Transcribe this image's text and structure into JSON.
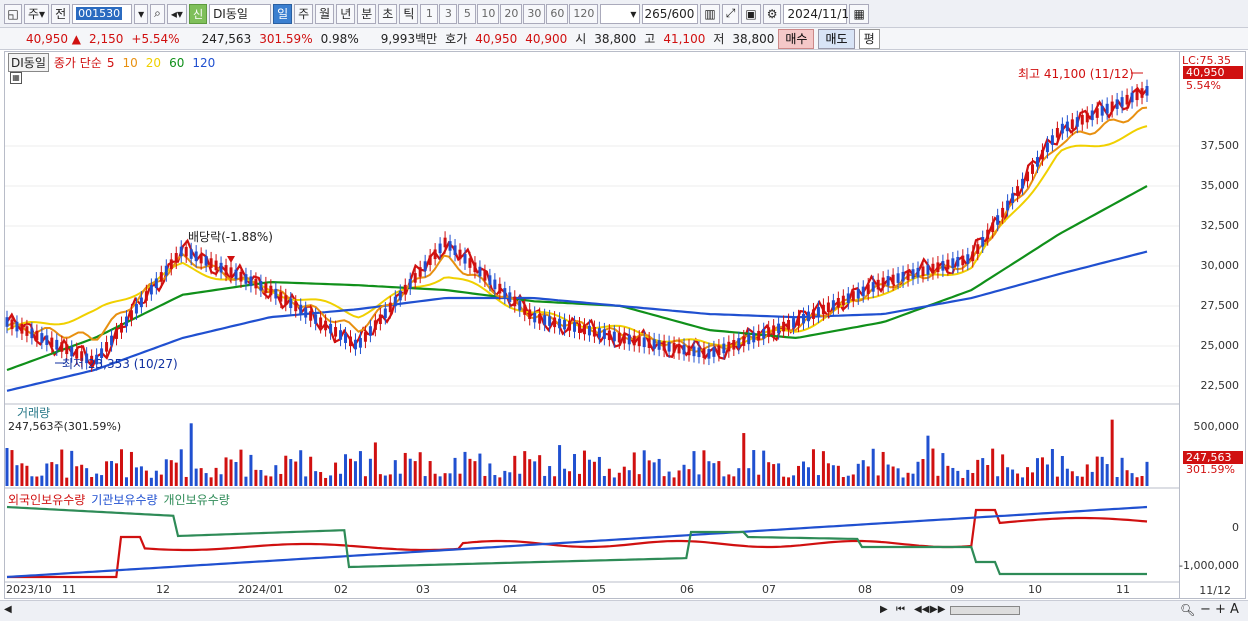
{
  "toolbar": {
    "market": "주",
    "prefix": "전",
    "stock_code": "001530",
    "badge": "신",
    "stock_name": "DI동일",
    "periods": [
      "일",
      "주",
      "월",
      "년",
      "분",
      "초",
      "틱"
    ],
    "selected_period": "일",
    "intervals": [
      "1",
      "3",
      "5",
      "10",
      "20",
      "30",
      "60",
      "120"
    ],
    "count": "265",
    "count_total": "/600",
    "date": "2024/11/12"
  },
  "quote": {
    "price": "40,950 ▲",
    "change": "2,150",
    "change_pct": "+5.54%",
    "volume": "247,563",
    "vol_ratio": "301.59%",
    "turnover": "0.98%",
    "amount": "9,993백만",
    "ask_label": "호가",
    "ask": "40,950",
    "bid": "40,900",
    "open_label": "시",
    "open": "38,800",
    "high_label": "고",
    "high": "41,100",
    "low_label": "저",
    "low": "38,800",
    "buy": "매수",
    "sell": "매도",
    "avg": "평"
  },
  "price_panel": {
    "name_tag": "DI동일",
    "ma_label": "종가 단순",
    "ma_periods": [
      {
        "p": "5",
        "color": "#d01010"
      },
      {
        "p": "10",
        "color": "#e89010"
      },
      {
        "p": "20",
        "color": "#f0d000"
      },
      {
        "p": "60",
        "color": "#10901a"
      },
      {
        "p": "120",
        "color": "#2050d0"
      }
    ],
    "lc": "LC:75.35",
    "last_price": "40,950",
    "last_pct": "5.54%",
    "high_note": "최고 41,100 (11/12)",
    "low_note": "최저 23,353 (10/27)",
    "dividend_note": "배당락(-1.88%)",
    "yticks": [
      "37,500",
      "35,000",
      "32,500",
      "30,000",
      "27,500",
      "25,000",
      "22,500"
    ]
  },
  "volume_panel": {
    "title": "거래량",
    "value": "247,563주(301.59%)",
    "ytick": "500,000",
    "last": "247,563",
    "last_pct": "301.59%"
  },
  "holder_panel": {
    "legend": [
      "외국인보유수량",
      "기관보유수량",
      "개인보유수량"
    ],
    "colors": [
      "#d01010",
      "#2050d0",
      "#2e8b57"
    ],
    "yticks": [
      "0",
      "-1,000,000"
    ]
  },
  "x_labels": [
    "2023/10",
    "11",
    "12",
    "2024/01",
    "02",
    "03",
    "04",
    "05",
    "06",
    "07",
    "08",
    "09",
    "10",
    "11"
  ],
  "x_end": "11/12",
  "chart_data": {
    "type": "line",
    "title": "",
    "x": [
      "2023/10",
      "11",
      "12",
      "2024/01",
      "02",
      "03",
      "04",
      "05",
      "06",
      "07",
      "08",
      "09",
      "10",
      "11/12"
    ],
    "series": [
      {
        "name": "종가 단순 5",
        "values": [
          26500,
          24000,
          31000,
          28500,
          25000,
          31500,
          26800,
          25500,
          24500,
          26500,
          29000,
          30500,
          38500,
          40950
        ]
      },
      {
        "name": "종가 단순 20",
        "values": [
          26000,
          27000,
          30000,
          28500,
          27000,
          29500,
          27000,
          26000,
          25000,
          26000,
          28500,
          30000,
          37000,
          38500
        ]
      },
      {
        "name": "종가 단순 60",
        "values": [
          23500,
          25500,
          28200,
          29000,
          28800,
          28500,
          27800,
          27500,
          26000,
          25500,
          26500,
          28500,
          32000,
          35000
        ]
      },
      {
        "name": "종가 단순 120",
        "values": [
          22200,
          23500,
          25500,
          26800,
          27300,
          28000,
          28000,
          27500,
          27000,
          26800,
          27000,
          28000,
          29500,
          30900
        ]
      }
    ],
    "ylim": [
      21500,
      42000
    ]
  }
}
